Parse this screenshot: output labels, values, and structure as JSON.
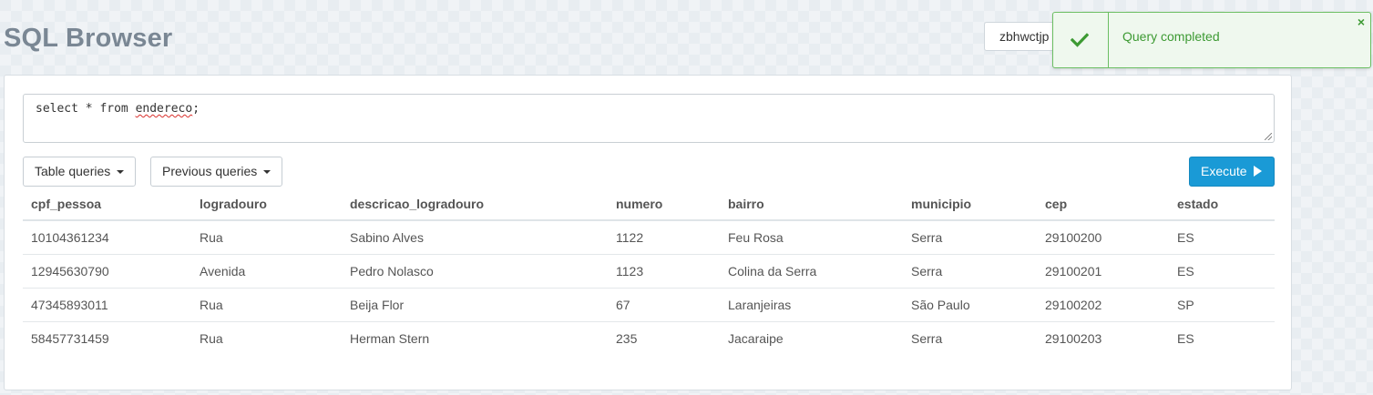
{
  "app": {
    "title": "SQL Browser",
    "user": "zbhwctjp"
  },
  "query": {
    "prefix": "select * from ",
    "misspelled_word": "endereco",
    "suffix": ";"
  },
  "toolbar": {
    "table_queries_label": "Table queries",
    "previous_queries_label": "Previous queries",
    "execute_label": "Execute"
  },
  "results": {
    "columns": [
      "cpf_pessoa",
      "logradouro",
      "descricao_logradouro",
      "numero",
      "bairro",
      "municipio",
      "cep",
      "estado"
    ],
    "rows": [
      [
        "10104361234",
        "Rua",
        "Sabino Alves",
        "1122",
        "Feu Rosa",
        "Serra",
        "29100200",
        "ES"
      ],
      [
        "12945630790",
        "Avenida",
        "Pedro Nolasco",
        "1123",
        "Colina da Serra",
        "Serra",
        "29100201",
        "ES"
      ],
      [
        "47345893011",
        "Rua",
        "Beija Flor",
        "67",
        "Laranjeiras",
        "São Paulo",
        "29100202",
        "SP"
      ],
      [
        "58457731459",
        "Rua",
        "Herman Stern",
        "235",
        "Jacaraipe",
        "Serra",
        "29100203",
        "ES"
      ]
    ]
  },
  "notification": {
    "message": "Query completed",
    "close_symbol": "×",
    "icon": "check-icon"
  },
  "colors": {
    "accent": "#1a9ad6",
    "success": "#3d9a33",
    "title": "#7a8794"
  }
}
